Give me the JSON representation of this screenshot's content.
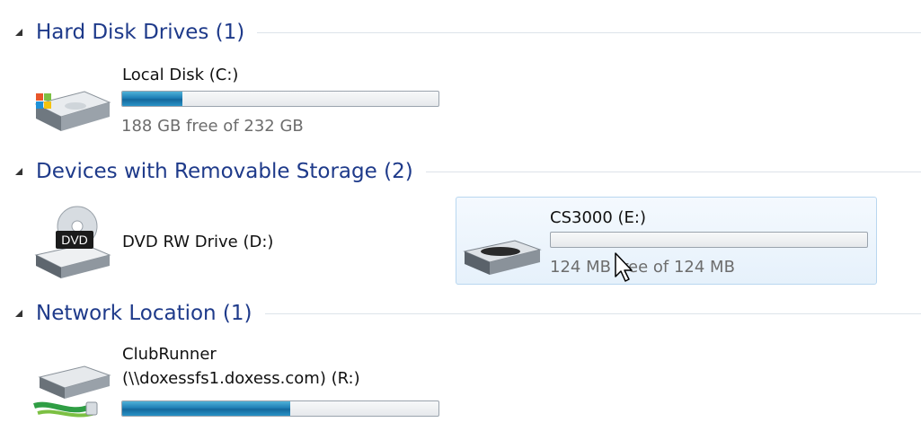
{
  "groups": {
    "hdd": {
      "title": "Hard Disk Drives (1)"
    },
    "removable": {
      "title": "Devices with Removable Storage (2)"
    },
    "network": {
      "title": "Network Location (1)"
    }
  },
  "drives": {
    "local_c": {
      "name": "Local Disk (C:)",
      "space": "188 GB free of 232 GB",
      "used_fraction": 0.19
    },
    "dvd_d": {
      "name": "DVD RW Drive (D:)",
      "icon_text": "DVD"
    },
    "cs3000_e": {
      "name": "CS3000 (E:)",
      "space": "124 MB free of 124 MB",
      "used_fraction": 0.0
    },
    "network_r": {
      "name_line1": "ClubRunner",
      "name_line2": "(\\\\doxessfs1.doxess.com) (R:)",
      "used_fraction": 0.53
    }
  },
  "icons": [
    "collapse-triangle-icon",
    "windows-hard-disk-icon",
    "dvd-drive-icon",
    "removable-drive-icon",
    "network-drive-icon",
    "mouse-cursor-icon"
  ],
  "colors": {
    "group_title": "#1e3a8a",
    "bar_fill": "#1f7fb6",
    "selection": "#e6f1fb"
  }
}
